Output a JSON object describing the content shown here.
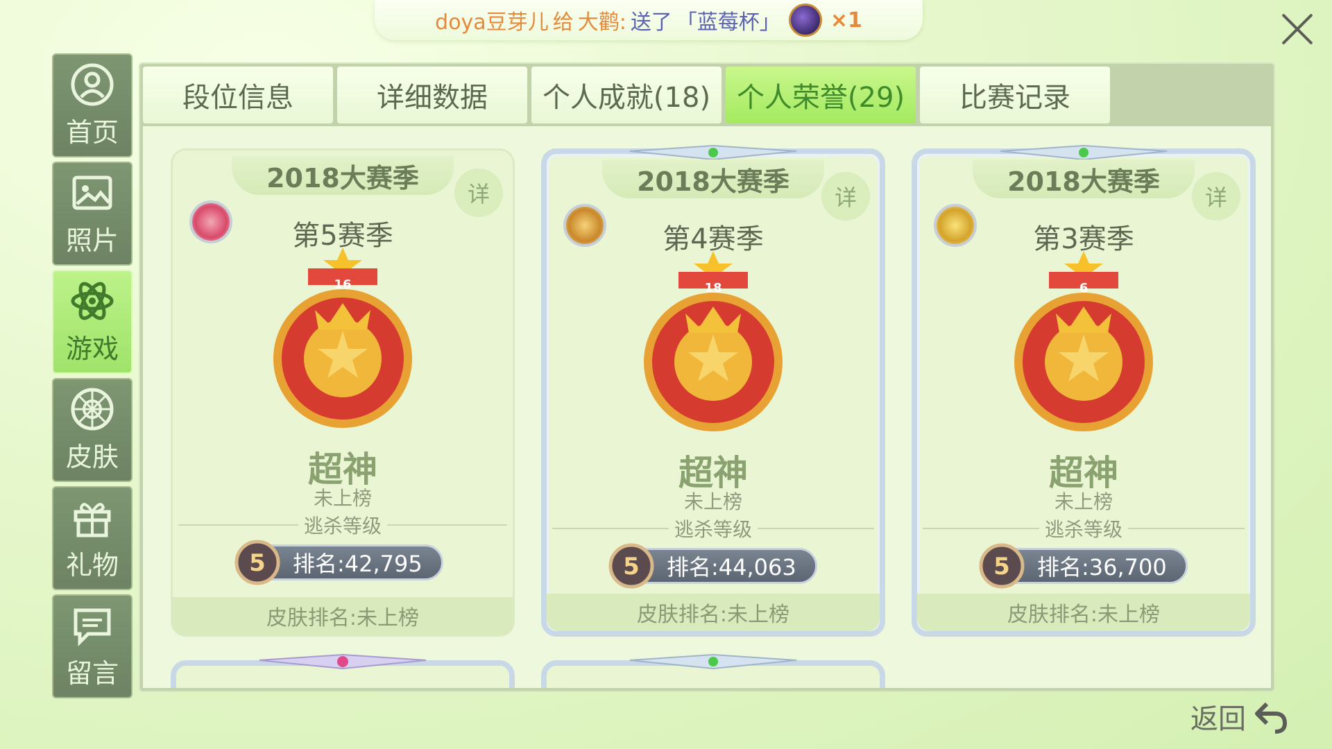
{
  "notice": {
    "sender": "doya豆芽儿",
    "verb": "给",
    "receiver": "大鹳:",
    "action": "送了",
    "gift": "「蓝莓杯」",
    "count": "×1"
  },
  "sidebar": {
    "items": [
      {
        "label": "首页",
        "icon": "user-icon"
      },
      {
        "label": "照片",
        "icon": "photo-icon"
      },
      {
        "label": "游戏",
        "icon": "atom-icon",
        "active": true
      },
      {
        "label": "皮肤",
        "icon": "flower-icon"
      },
      {
        "label": "礼物",
        "icon": "gift-icon"
      },
      {
        "label": "留言",
        "icon": "message-icon"
      }
    ]
  },
  "tabs": [
    {
      "label": "段位信息"
    },
    {
      "label": "详细数据"
    },
    {
      "label": "个人成就(18)"
    },
    {
      "label": "个人荣誉(29)",
      "active": true
    },
    {
      "label": "比赛记录"
    }
  ],
  "cards": [
    {
      "season_year": "2018大赛季",
      "detail": "详",
      "season": "第5赛季",
      "medal_number": "16",
      "tier": "超神",
      "board": "未上榜",
      "level_label": "逃杀等级",
      "level_badge": "5",
      "rank": "排名:42,795",
      "skin_rank": "皮肤排名:未上榜"
    },
    {
      "season_year": "2018大赛季",
      "detail": "详",
      "season": "第4赛季",
      "medal_number": "18",
      "tier": "超神",
      "board": "未上榜",
      "level_label": "逃杀等级",
      "level_badge": "5",
      "rank": "排名:44,063",
      "skin_rank": "皮肤排名:未上榜"
    },
    {
      "season_year": "2018大赛季",
      "detail": "详",
      "season": "第3赛季",
      "medal_number": "6",
      "tier": "超神",
      "board": "未上榜",
      "level_label": "逃杀等级",
      "level_badge": "5",
      "rank": "排名:36,700",
      "skin_rank": "皮肤排名:未上榜"
    }
  ],
  "back": {
    "label": "返回"
  },
  "colors": {
    "accent": "#a3ea5f",
    "panel": "#c2d3ac",
    "content": "#eef8dc"
  }
}
